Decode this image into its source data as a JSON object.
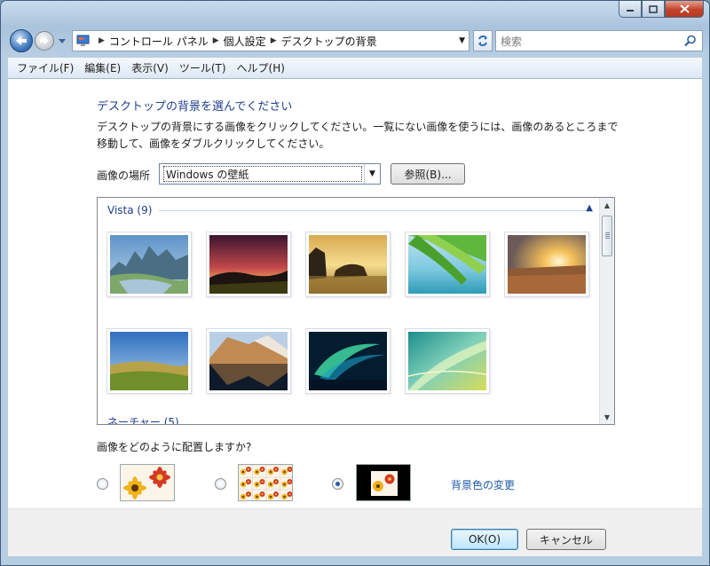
{
  "window": {
    "caption_buttons": [
      {
        "name": "minimize-icon",
        "glyph": "–"
      },
      {
        "name": "maximize-icon",
        "glyph": "□"
      },
      {
        "name": "close-icon",
        "glyph": "✕"
      }
    ]
  },
  "address_bar": {
    "crumbs": [
      "コントロール パネル",
      "個人設定",
      "デスクトップの背景"
    ],
    "search_placeholder": "検索"
  },
  "menu": {
    "items": [
      "ファイル(F)",
      "編集(E)",
      "表示(V)",
      "ツール(T)",
      "ヘルプ(H)"
    ]
  },
  "content": {
    "heading": "デスクトップの背景を選んでください",
    "description": "デスクトップの背景にする画像をクリックしてください。一覧にない画像を使うには、画像のあるところまで移動して、画像をダブルクリックしてください。",
    "location_label": "画像の場所",
    "location_value": "Windows の壁紙",
    "browse_label": "参照(B)...",
    "gallery": {
      "group_title": "Vista (9)",
      "next_group_title": "ネーチャー (5)"
    },
    "position_question": "画像をどのように配置しますか?",
    "position_options": [
      {
        "name": "fit-screen",
        "selected": false
      },
      {
        "name": "tile",
        "selected": false
      },
      {
        "name": "center",
        "selected": true
      }
    ],
    "background_color_link": "背景色の変更"
  },
  "footer": {
    "ok_label": "OK(O)",
    "cancel_label": "キャンセル"
  },
  "colors": {
    "heading": "#1e3f8a",
    "link": "#1e5aa8"
  }
}
